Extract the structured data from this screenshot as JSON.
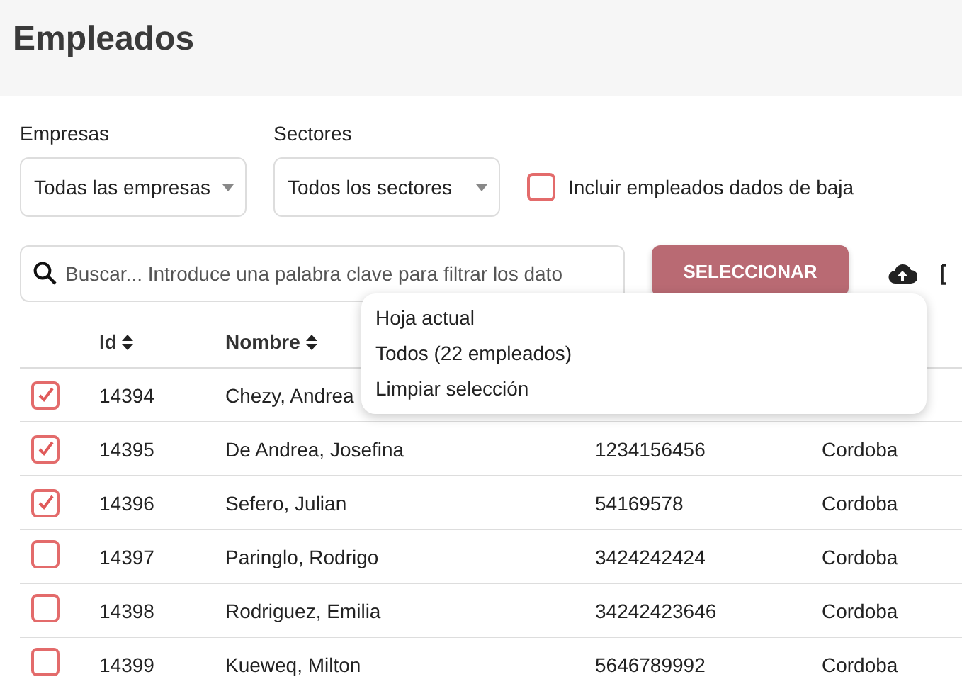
{
  "page": {
    "title": "Empleados"
  },
  "filters": [
    {
      "label": "Empresas",
      "value": "Todas las empresas"
    },
    {
      "label": "Sectores",
      "value": "Todos los sectores"
    }
  ],
  "include_inactive": {
    "label": "Incluir empleados dados de baja",
    "checked": false
  },
  "search": {
    "placeholder": "Buscar... Introduce una palabra clave para filtrar los dato"
  },
  "select_button": {
    "label": "SELECCIONAR"
  },
  "select_menu": [
    {
      "label": "Hoja actual"
    },
    {
      "label": "Todos (22 empleados)"
    },
    {
      "label": "Limpiar selección"
    }
  ],
  "table": {
    "columns": [
      {
        "label": "Id",
        "sortable": true
      },
      {
        "label": "Nombre",
        "sortable": true
      }
    ],
    "rows": [
      {
        "selected": true,
        "id": "14394",
        "name": "Chezy, Andrea"
      },
      {
        "selected": true,
        "id": "14395",
        "name": "De Andrea, Josefina",
        "column_3": "1234156456",
        "column_4": "Cordoba"
      },
      {
        "selected": true,
        "id": "14396",
        "name": "Sefero, Julian",
        "column_3": "54169578",
        "column_4": "Cordoba"
      },
      {
        "selected": false,
        "id": "14397",
        "name": "Paringlo, Rodrigo",
        "column_3": "3424242424",
        "column_4": "Cordoba"
      },
      {
        "selected": false,
        "id": "14398",
        "name": "Rodriguez, Emilia",
        "column_3": "34242423646",
        "column_4": "Cordoba"
      },
      {
        "selected": false,
        "id": "14399",
        "name": "Kueweq, Milton",
        "column_3": "5646789992",
        "column_4": "Cordoba"
      }
    ]
  }
}
